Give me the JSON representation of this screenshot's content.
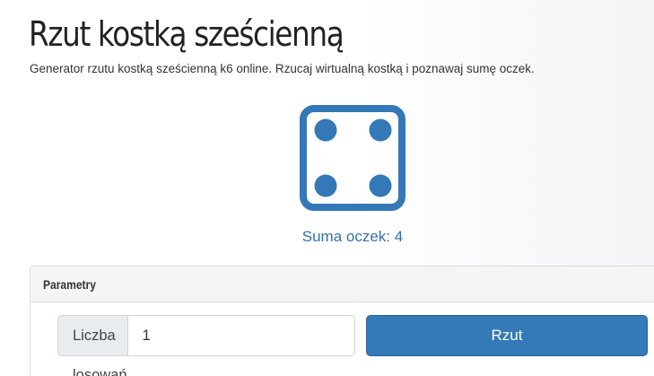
{
  "header": {
    "title": "Rzut kostką sześcienną",
    "subtitle": "Generator rzutu kostką sześcienną k6 online. Rzucaj wirtualną kostką i poznawaj sumę oczek."
  },
  "die": {
    "value": 4,
    "icon": "die-face-four-icon",
    "color": "#3478b8"
  },
  "result": {
    "sum_text": "Suma oczek: 4"
  },
  "parameters": {
    "title": "Parametry",
    "count_label": "Liczba losowań",
    "count_value": "1",
    "roll_label": "Rzut"
  },
  "colors": {
    "accent": "#337ab7",
    "result_text": "#3570b0"
  }
}
